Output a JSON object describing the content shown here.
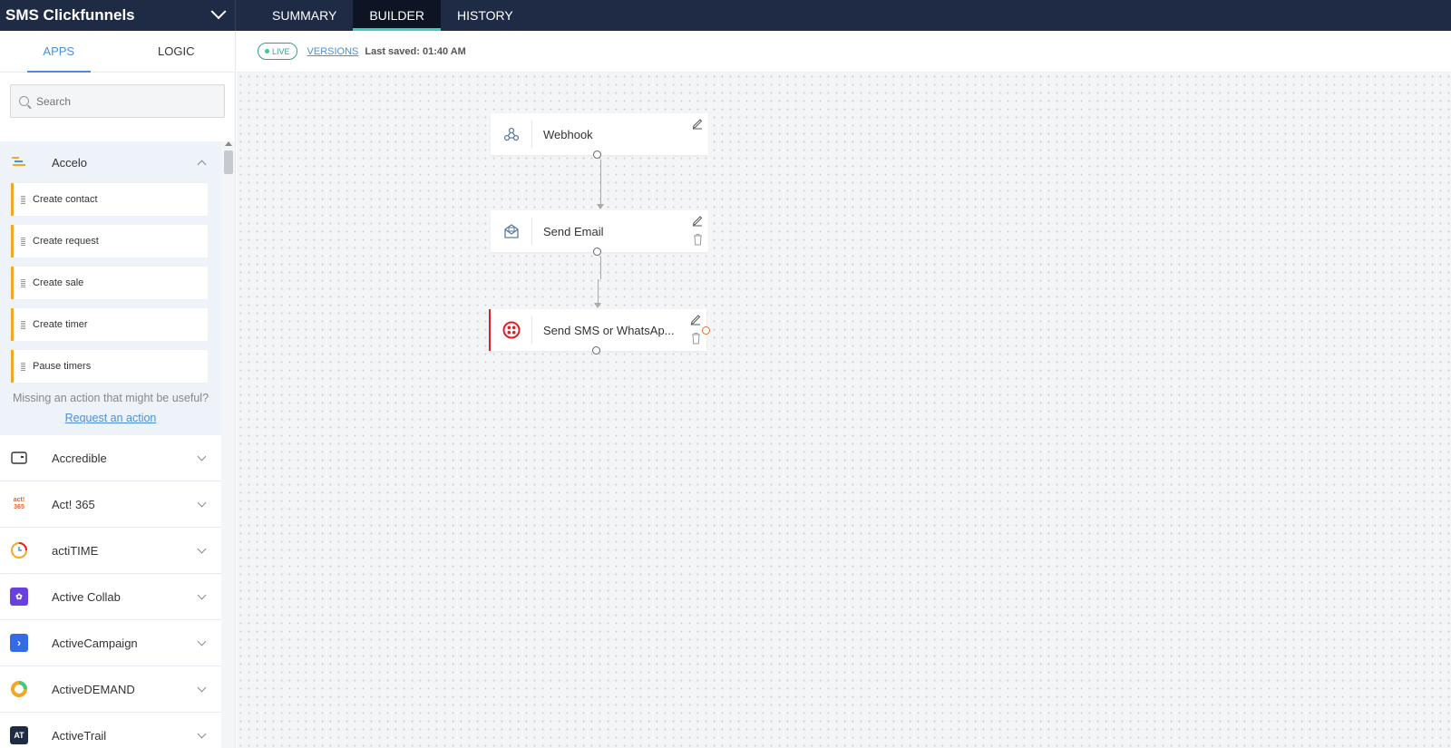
{
  "workflow": {
    "title": "SMS Clickfunnels"
  },
  "nav": {
    "tabs": [
      {
        "label": "SUMMARY"
      },
      {
        "label": "BUILDER"
      },
      {
        "label": "HISTORY"
      }
    ],
    "active": "BUILDER"
  },
  "panel": {
    "tabs": [
      {
        "label": "APPS"
      },
      {
        "label": "LOGIC"
      }
    ],
    "active": "APPS",
    "search": {
      "placeholder": "Search",
      "value": ""
    }
  },
  "expanded_app": {
    "name": "Accelo",
    "actions": [
      {
        "label": "Create contact"
      },
      {
        "label": "Create request"
      },
      {
        "label": "Create sale"
      },
      {
        "label": "Create timer"
      },
      {
        "label": "Pause timers"
      }
    ],
    "missing_text": "Missing an action that might be useful?",
    "request_link": "Request an action"
  },
  "apps": [
    {
      "name": "Accredible",
      "icon": "card-icon"
    },
    {
      "name": "Act! 365",
      "icon": "act365-logo",
      "logo_text": "act! 365"
    },
    {
      "name": "actiTIME",
      "icon": "actitime-logo"
    },
    {
      "name": "Active Collab",
      "icon": "activecollab-logo"
    },
    {
      "name": "ActiveCampaign",
      "icon": "activecampaign-logo"
    },
    {
      "name": "ActiveDEMAND",
      "icon": "activedemand-logo"
    },
    {
      "name": "ActiveTrail",
      "icon": "activetrail-logo",
      "logo_text": "AT"
    }
  ],
  "subheader": {
    "status": "LIVE",
    "versions_label": "VERSIONS",
    "last_saved": "Last saved: 01:40 AM"
  },
  "flow": {
    "nodes": [
      {
        "label": "Webhook",
        "icon": "webhook-icon",
        "status": "ok"
      },
      {
        "label": "Send Email",
        "icon": "email-icon",
        "status": "ok"
      },
      {
        "label": "Send SMS or WhatsAp...",
        "icon": "twilio-icon",
        "status": "error"
      }
    ]
  },
  "colors": {
    "topbar": "#1f2a44",
    "accent": "#3ccbc1",
    "link": "#4a8fdb",
    "action_border": "#f5a623",
    "error": "#e02020"
  }
}
